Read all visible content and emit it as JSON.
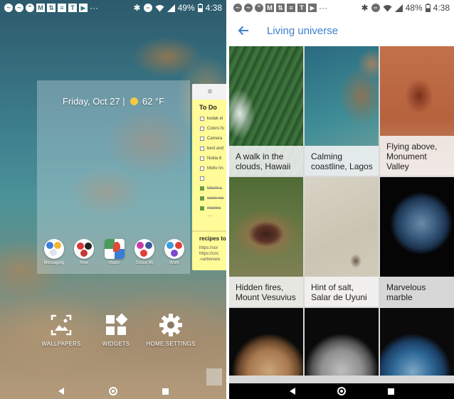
{
  "left": {
    "status": {
      "battery": "49%",
      "time": "4:38"
    },
    "widget": {
      "date": "Friday, Oct 27",
      "separator": "|",
      "temperature": "62 °F"
    },
    "apps": [
      {
        "label": "Messaging"
      },
      {
        "label": "Now"
      },
      {
        "label": "Maps"
      },
      {
        "label": "Social Mi"
      },
      {
        "label": "Work"
      }
    ],
    "note": {
      "title": "To Do",
      "items": [
        {
          "text": "kodak el",
          "done": false
        },
        {
          "text": "Colors fo",
          "done": false
        },
        {
          "text": "Camera",
          "done": false
        },
        {
          "text": "best and",
          "done": false
        },
        {
          "text": "Nokia 6",
          "done": false
        },
        {
          "text": "Motiv rin",
          "done": false
        },
        {
          "text": "",
          "done": false
        },
        {
          "text": "Moshi a",
          "done": true
        },
        {
          "text": "casio wa",
          "done": true
        },
        {
          "text": "moxieo",
          "done": true
        }
      ],
      "ellipsis": "...",
      "recipes_title": "recipes to",
      "recipes_links": [
        "https://sor",
        "https://coc",
        "-carbonara"
      ]
    },
    "actions": [
      {
        "label": "WALLPAPERS"
      },
      {
        "label": "WIDGETS"
      },
      {
        "label": "HOME SETTINGS"
      }
    ]
  },
  "right": {
    "status": {
      "battery": "48%",
      "time": "4:38"
    },
    "header": {
      "title": "Living universe"
    },
    "tiles": [
      {
        "caption": "A walk in the clouds, Hawaii"
      },
      {
        "caption": "Calming coastline, Lagos"
      },
      {
        "caption": "Flying above, Monument Valley"
      },
      {
        "caption": "Hidden fires, Mount Vesuvius"
      },
      {
        "caption": "Hint of salt, Salar de Uyuni"
      },
      {
        "caption": "Marvelous marble"
      }
    ]
  },
  "colors": {
    "accent": "#3c7fd1",
    "note_yellow": "#fffb99"
  },
  "icons": {
    "status": [
      "messenger-icon",
      "messenger-icon",
      "hangouts-icon",
      "gmail-icon",
      "retweet-icon",
      "news-icon",
      "nyt-icon",
      "youtube-icon",
      "more-dots-icon",
      "bluetooth-icon",
      "dnd-icon",
      "wifi-icon",
      "signal-icon",
      "battery-icon"
    ],
    "actions": [
      "wallpaper-icon",
      "widgets-icon",
      "gear-icon"
    ]
  }
}
